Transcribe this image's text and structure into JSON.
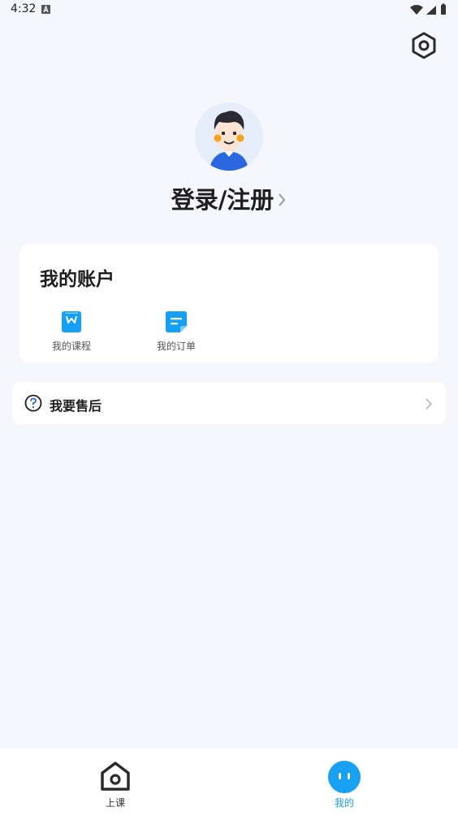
{
  "status_bar": {
    "time": "4:32",
    "icons": [
      "notification-a-icon",
      "wifi-icon",
      "signal-icon",
      "battery-icon"
    ]
  },
  "header": {
    "settings_icon": "hexagon-gear-icon"
  },
  "profile": {
    "login_label": "登录/注册"
  },
  "account": {
    "title": "我的账户",
    "items": [
      {
        "label": "我的课程",
        "icon": "course-book-icon"
      },
      {
        "label": "我的订单",
        "icon": "order-list-icon"
      }
    ]
  },
  "support": {
    "label": "我要售后",
    "icon": "question-circle-icon"
  },
  "tabbar": {
    "tabs": [
      {
        "label": "上课",
        "icon": "class-home-icon",
        "active": false
      },
      {
        "label": "我的",
        "icon": "mine-face-icon",
        "active": true
      }
    ]
  },
  "colors": {
    "accent": "#18a0f2",
    "background": "#f5f7fc",
    "card": "#ffffff",
    "text_primary": "#1e1e1e"
  }
}
